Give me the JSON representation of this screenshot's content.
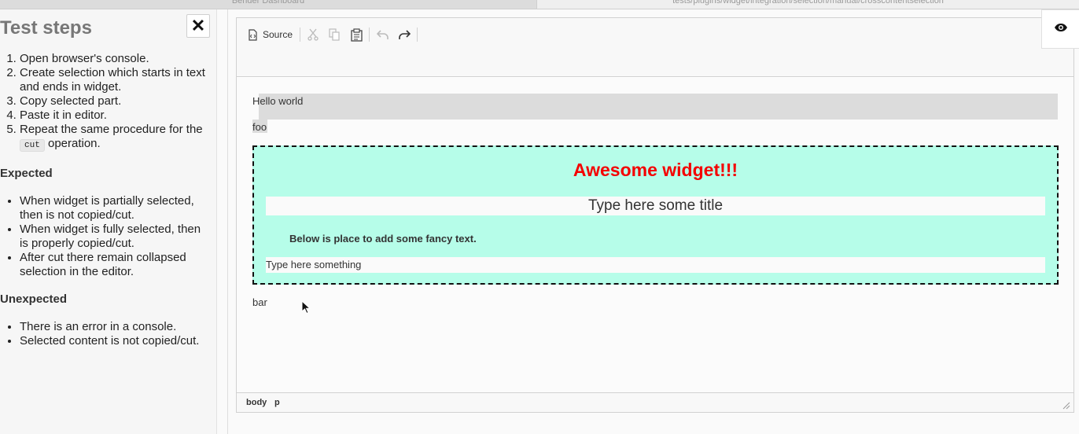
{
  "browser_tabs": [
    "Bender Dashboard",
    "tests/plugins/widget/integration/selection/manual/crosscontentselection"
  ],
  "sidebar": {
    "title": "Test steps",
    "close_icon": "close-icon",
    "steps": [
      "Open browser's console.",
      "Create selection which starts in text and ends in widget.",
      "Copy selected part.",
      "Paste it in editor.",
      {
        "before": "Repeat the same procedure for the ",
        "code": "cut",
        "after": " operation."
      }
    ],
    "expected_heading": "Expected",
    "expected": [
      "When widget is partially selected, then is not copied/cut.",
      "When widget is fully selected, then is properly copied/cut.",
      "After cut there remain collapsed selection in the editor."
    ],
    "unexpected_heading": "Unexpected",
    "unexpected": [
      "There is an error in a console.",
      "Selected content is not copied/cut."
    ]
  },
  "toolbar": {
    "source_label": "Source",
    "icons": [
      "source-icon",
      "cut-icon",
      "copy-icon",
      "paste-icon",
      "undo-icon",
      "redo-icon"
    ]
  },
  "editor": {
    "para1": "Hello world",
    "para2": "foo",
    "widget": {
      "title": "Awesome widget!!!",
      "field1": "Type here some title",
      "note": "Below is place to add some fancy text.",
      "field2": "Type here something"
    },
    "para3": "bar"
  },
  "statusbar": {
    "crumbs": [
      "body",
      "p"
    ]
  },
  "colors": {
    "widget_bg": "#b6fde9",
    "widget_title": "#f40000",
    "selection": "#dcdcdc"
  },
  "preview_icon": "eye-icon"
}
